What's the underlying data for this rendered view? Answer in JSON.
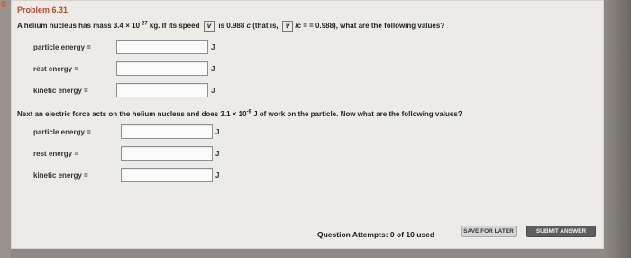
{
  "problem": {
    "title": "Problem 6.31",
    "statement": {
      "prefix": "A helium nucleus has mass 3.4 × 10",
      "mass_exp": "-27",
      "mass_suffix": " kg. If its speed",
      "speed_mid": " is 0.988",
      "c_text": "c",
      "that_is": " (that is,",
      "over_c": "/c = ",
      "equals_value": "= 0.988), what are the following values?"
    },
    "vector_symbol": "v"
  },
  "first_fields": [
    {
      "label": "particle energy =",
      "unit": "J"
    },
    {
      "label": "rest energy =",
      "unit": "J"
    },
    {
      "label": "kinetic energy =",
      "unit": "J"
    }
  ],
  "second_part": {
    "prefix": "Next an electric force acts on the helium nucleus and does 3.1 × 10",
    "work_exp": "-9",
    "suffix": " J of work on the particle. Now what are the following values?"
  },
  "second_fields": [
    {
      "label": "particle energy =",
      "unit": "J"
    },
    {
      "label": "rest energy =",
      "unit": "J"
    },
    {
      "label": "kinetic energy =",
      "unit": "J"
    }
  ],
  "footer": {
    "attempts": "Question Attempts: 0 of 10 used",
    "save_later": "SAVE FOR LATER",
    "submit": "SUBMIT ANSWER"
  },
  "left_tab_text": "S"
}
